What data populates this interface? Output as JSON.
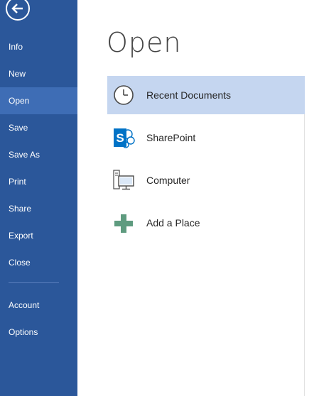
{
  "colors": {
    "sidebar_bg": "#2b579a",
    "sidebar_active": "#3e6db5",
    "selected_place_bg": "#c5d6f0",
    "sharepoint_blue": "#0072c6",
    "add_place_green": "#5e9b7f"
  },
  "sidebar": {
    "back_icon": "back-arrow-icon",
    "items": [
      {
        "label": "Info"
      },
      {
        "label": "New"
      },
      {
        "label": "Open",
        "active": true
      },
      {
        "label": "Save"
      },
      {
        "label": "Save As"
      },
      {
        "label": "Print"
      },
      {
        "label": "Share"
      },
      {
        "label": "Export"
      },
      {
        "label": "Close"
      }
    ],
    "bottom_items": [
      {
        "label": "Account"
      },
      {
        "label": "Options"
      }
    ]
  },
  "main": {
    "title": "Open",
    "places": [
      {
        "label": "Recent Documents",
        "icon": "clock-icon",
        "selected": true
      },
      {
        "label": "SharePoint",
        "icon": "sharepoint-icon"
      },
      {
        "label": "Computer",
        "icon": "computer-icon"
      },
      {
        "label": "Add a Place",
        "icon": "plus-icon"
      }
    ]
  }
}
